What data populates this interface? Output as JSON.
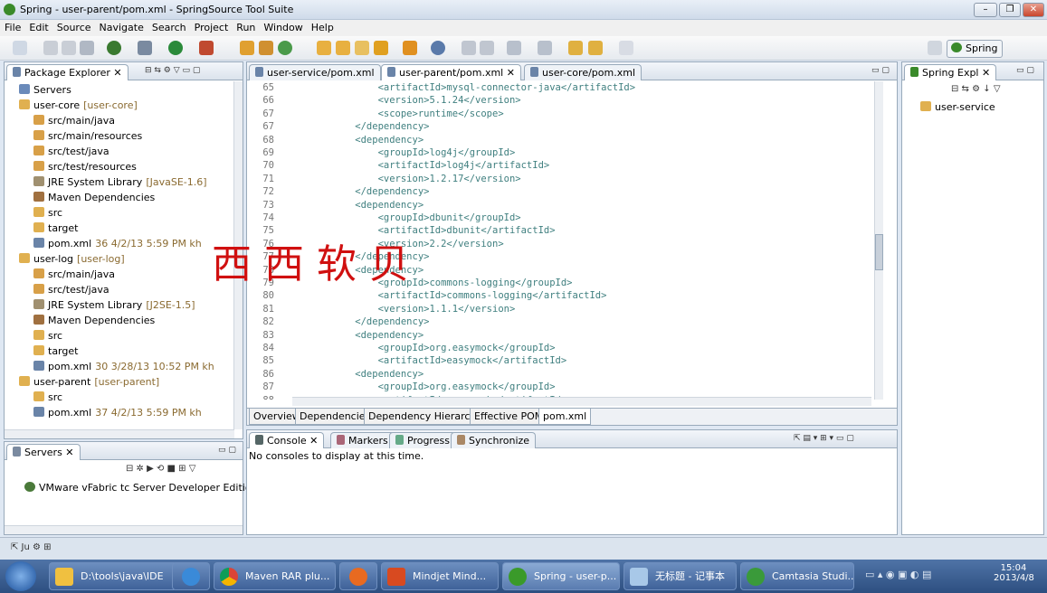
{
  "window": {
    "title": "Spring - user-parent/pom.xml - SpringSource Tool Suite"
  },
  "menu": [
    "File",
    "Edit",
    "Source",
    "Navigate",
    "Search",
    "Project",
    "Run",
    "Window",
    "Help"
  ],
  "perspective": {
    "label": "Spring"
  },
  "package_explorer": {
    "title": "Package Explorer",
    "items": [
      {
        "label": "Servers"
      },
      {
        "label": "user-core",
        "suffix": "[user-core]"
      },
      {
        "label": "src/main/java"
      },
      {
        "label": "src/main/resources"
      },
      {
        "label": "src/test/java"
      },
      {
        "label": "src/test/resources"
      },
      {
        "label": "JRE System Library",
        "suffix": "[JavaSE-1.6]"
      },
      {
        "label": "Maven Dependencies"
      },
      {
        "label": "src"
      },
      {
        "label": "target"
      },
      {
        "label": "pom.xml",
        "suffix": "36  4/2/13 5:59 PM  kh"
      },
      {
        "label": "user-log",
        "suffix": "[user-log]"
      },
      {
        "label": "src/main/java"
      },
      {
        "label": "src/test/java"
      },
      {
        "label": "JRE System Library",
        "suffix": "[J2SE-1.5]"
      },
      {
        "label": "Maven Dependencies"
      },
      {
        "label": "src"
      },
      {
        "label": "target"
      },
      {
        "label": "pom.xml",
        "suffix": "30  3/28/13 10:52 PM  kh"
      },
      {
        "label": "user-parent",
        "suffix": "[user-parent]"
      },
      {
        "label": "src"
      },
      {
        "label": "pom.xml",
        "suffix": "37  4/2/13 5:59 PM  kh"
      }
    ]
  },
  "servers": {
    "title": "Servers",
    "item": "VMware vFabric tc Server Developer Edition v"
  },
  "editor": {
    "tabs": [
      "user-service/pom.xml",
      "user-parent/pom.xml",
      "user-core/pom.xml"
    ],
    "lines": [
      {
        "n": "65",
        "t": "        <artifactId>mysql-connector-java</artifactId>"
      },
      {
        "n": "66",
        "t": "        <version>5.1.24</version>"
      },
      {
        "n": "67",
        "t": "        <scope>runtime</scope>"
      },
      {
        "n": "67",
        "t": "    </dependency>"
      },
      {
        "n": "68",
        "t": "    <dependency>"
      },
      {
        "n": "69",
        "t": "        <groupId>log4j</groupId>"
      },
      {
        "n": "70",
        "t": "        <artifactId>log4j</artifactId>"
      },
      {
        "n": "71",
        "t": "        <version>1.2.17</version>"
      },
      {
        "n": "72",
        "t": "    </dependency>"
      },
      {
        "n": "73",
        "t": "    <dependency>"
      },
      {
        "n": "74",
        "t": "        <groupId>dbunit</groupId>"
      },
      {
        "n": "75",
        "t": "        <artifactId>dbunit</artifactId>"
      },
      {
        "n": "76",
        "t": "        <version>2.2</version>"
      },
      {
        "n": "77",
        "t": "    </dependency>"
      },
      {
        "n": "78",
        "t": "    <dependency>"
      },
      {
        "n": "79",
        "t": "        <groupId>commons-logging</groupId>"
      },
      {
        "n": "80",
        "t": "        <artifactId>commons-logging</artifactId>"
      },
      {
        "n": "81",
        "t": "        <version>1.1.1</version>"
      },
      {
        "n": "82",
        "t": "    </dependency>"
      },
      {
        "n": "83",
        "t": "    <dependency>"
      },
      {
        "n": "84",
        "t": "        <groupId>org.easymock</groupId>"
      },
      {
        "n": "85",
        "t": "        <artifactId>easymock</artifactId>"
      },
      {
        "n": "86",
        "t": "    <dependency>"
      },
      {
        "n": "87",
        "t": "        <groupId>org.easymock</groupId>"
      },
      {
        "n": "88",
        "t": "        <artifactId>easymock</artifactId>"
      }
    ],
    "bottom_tabs": [
      "Overview",
      "Dependencies",
      "Dependency Hierarchy",
      "Effective POM",
      "pom.xml"
    ]
  },
  "watermark": "西 西 软 贝",
  "console": {
    "tabs": [
      "Console",
      "Markers",
      "Progress",
      "Synchronize"
    ],
    "message": "No consoles to display at this time."
  },
  "spring_explorer": {
    "title": "Spring Expl",
    "item": "user-service"
  },
  "taskbar": {
    "tasks": [
      "D:\\tools\\java\\IDE",
      "",
      "Maven RAR plu...",
      "",
      "Mindjet Mind...",
      "Spring - user-p...",
      "无标题 - 记事本",
      "Camtasia Studi..."
    ],
    "time": "15:04",
    "date": "2013/4/8"
  },
  "colors": {
    "tag": "#3f7f7f",
    "taskbar": "#2d4f80",
    "watermark": "#d01010"
  }
}
